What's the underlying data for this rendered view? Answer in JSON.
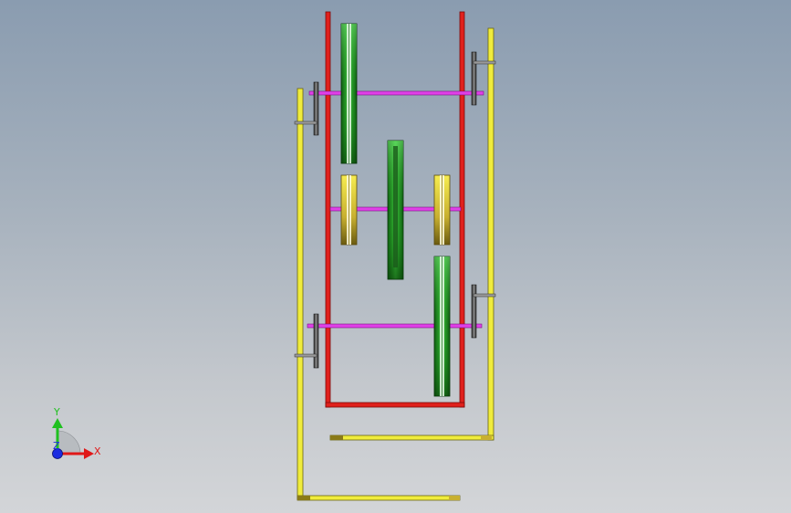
{
  "viewport": {
    "background_top": "#8a9cb0",
    "background_bottom": "#d3d5d8"
  },
  "model": {
    "frame_color": "#e0201c",
    "shaft_color": "#e040e8",
    "bracket_color": "#f0ec3c",
    "sheave_colors": [
      "#138a16",
      "#3cc83c",
      "#0e5a10"
    ],
    "idler_colors": [
      "#b8a020",
      "#f6ec50",
      "#6a5a10"
    ],
    "handle_color": "#4a4a4a"
  },
  "triad": {
    "x_label": "X",
    "y_label": "Y",
    "z_label": "Z",
    "x_color": "#e01818",
    "y_color": "#20c020",
    "z_color": "#1c2ce0"
  }
}
